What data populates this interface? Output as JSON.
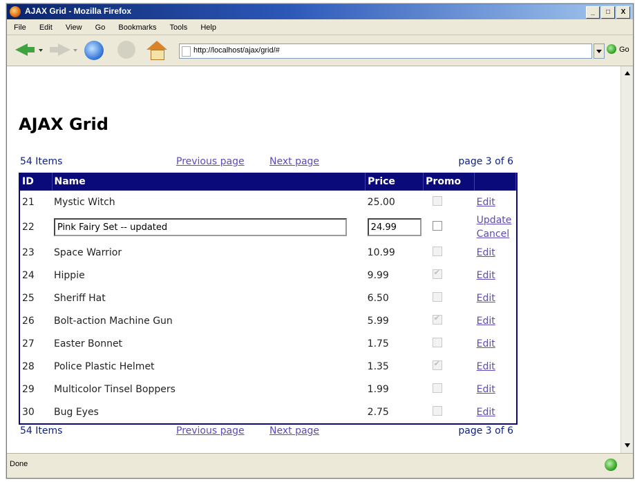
{
  "window": {
    "title": "AJAX Grid - Mozilla Firefox",
    "min_label": "_",
    "max_label": "□",
    "close_label": "X"
  },
  "menu": [
    "File",
    "Edit",
    "View",
    "Go",
    "Bookmarks",
    "Tools",
    "Help"
  ],
  "navbar": {
    "url": "http://localhost/ajax/grid/#",
    "go_label": "Go"
  },
  "page": {
    "title": "AJAX Grid",
    "items_label": "54 Items",
    "prev_label": "Previous page",
    "next_label": "Next page",
    "page_info": "page 3 of 6"
  },
  "grid": {
    "headers": {
      "id": "ID",
      "name": "Name",
      "price": "Price",
      "promo": "Promo"
    },
    "rows": [
      {
        "id": "21",
        "name": "Mystic Witch",
        "price": "25.00",
        "promo": false,
        "action": "Edit"
      },
      {
        "id": "22",
        "name": "Pink Fairy Set -- updated",
        "price": "24.99",
        "promo": false,
        "action_update": "Update",
        "action_cancel": "Cancel"
      },
      {
        "id": "23",
        "name": "Space Warrior",
        "price": "10.99",
        "promo": false,
        "action": "Edit"
      },
      {
        "id": "24",
        "name": "Hippie",
        "price": "9.99",
        "promo": true,
        "action": "Edit"
      },
      {
        "id": "25",
        "name": "Sheriff Hat",
        "price": "6.50",
        "promo": false,
        "action": "Edit"
      },
      {
        "id": "26",
        "name": "Bolt-action Machine Gun",
        "price": "5.99",
        "promo": true,
        "action": "Edit"
      },
      {
        "id": "27",
        "name": "Easter Bonnet",
        "price": "1.75",
        "promo": false,
        "action": "Edit"
      },
      {
        "id": "28",
        "name": "Police Plastic Helmet",
        "price": "1.35",
        "promo": true,
        "action": "Edit"
      },
      {
        "id": "29",
        "name": "Multicolor Tinsel Boppers",
        "price": "1.99",
        "promo": false,
        "action": "Edit"
      },
      {
        "id": "30",
        "name": "Bug Eyes",
        "price": "2.75",
        "promo": false,
        "action": "Edit"
      }
    ]
  },
  "status": {
    "text": "Done"
  },
  "colors": {
    "grid_header": "#0a0a7a",
    "link": "#5b4bbb",
    "pager_text": "#0a1f8f"
  }
}
